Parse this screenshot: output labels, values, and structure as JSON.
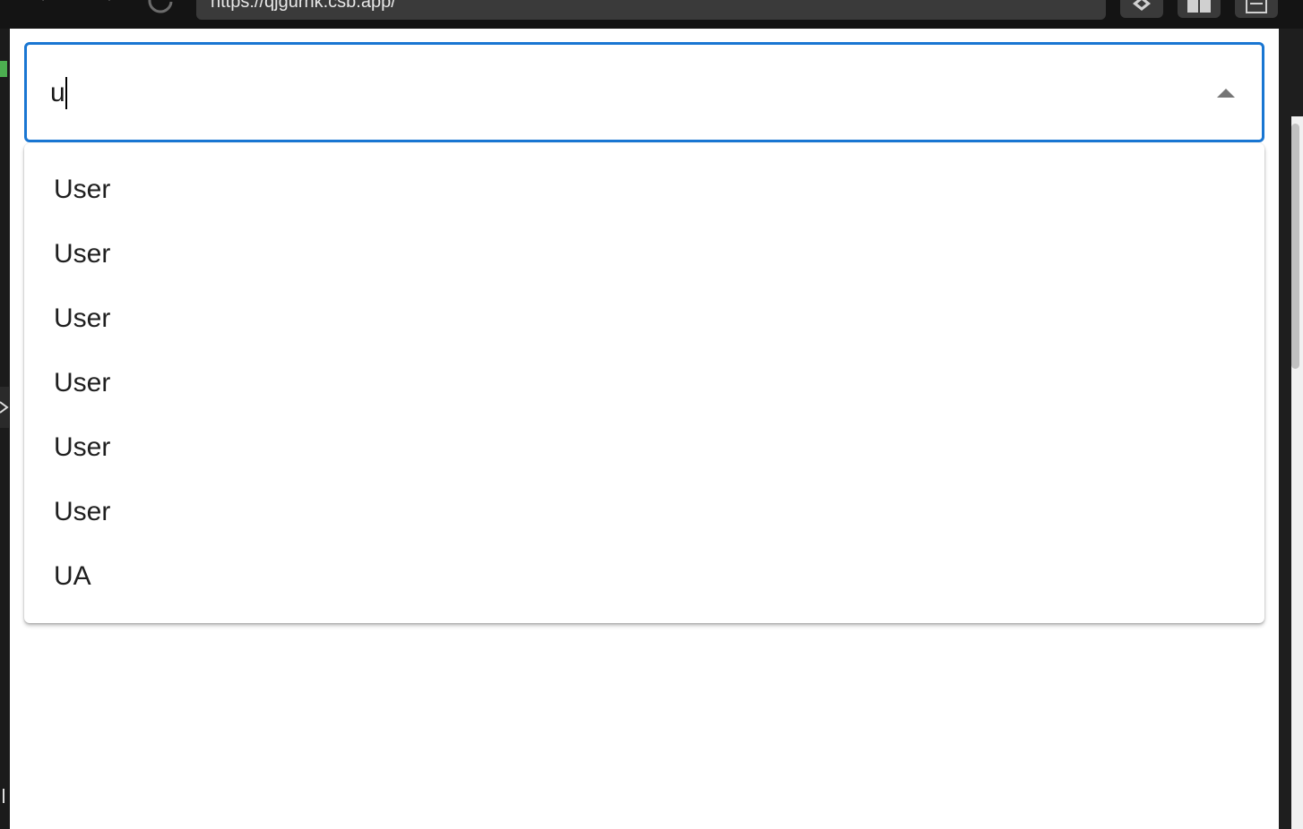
{
  "browser": {
    "url": "https://qjgurnk.csb.app/"
  },
  "autocomplete": {
    "input_value": "u",
    "accent_color": "#1976d2",
    "toggle_icon": "arrow-up-icon",
    "options": [
      {
        "label": "User"
      },
      {
        "label": "User"
      },
      {
        "label": "User"
      },
      {
        "label": "User"
      },
      {
        "label": "User"
      },
      {
        "label": "User"
      },
      {
        "label": "UA"
      }
    ]
  }
}
